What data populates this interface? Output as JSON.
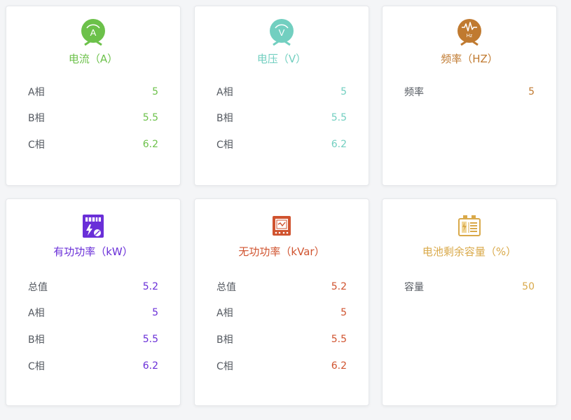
{
  "cards": [
    {
      "title": "电流（A）",
      "icon": "ammeter-icon",
      "color": "#6cc14a",
      "rows": [
        {
          "label": "A相",
          "value": "5"
        },
        {
          "label": "B相",
          "value": "5.5"
        },
        {
          "label": "C相",
          "value": "6.2"
        }
      ]
    },
    {
      "title": "电压（V）",
      "icon": "voltmeter-icon",
      "color": "#72cfc0",
      "rows": [
        {
          "label": "A相",
          "value": "5"
        },
        {
          "label": "B相",
          "value": "5.5"
        },
        {
          "label": "C相",
          "value": "6.2"
        }
      ]
    },
    {
      "title": "频率（HZ）",
      "icon": "frequency-icon",
      "color": "#c07a30",
      "rows": [
        {
          "label": "频率",
          "value": "5"
        }
      ]
    },
    {
      "title": "有功功率（kW）",
      "icon": "active-power-meter-icon",
      "color": "#6a2fd8",
      "rows": [
        {
          "label": "总值",
          "value": "5.2"
        },
        {
          "label": "A相",
          "value": "5"
        },
        {
          "label": "B相",
          "value": "5.5"
        },
        {
          "label": "C相",
          "value": "6.2"
        }
      ]
    },
    {
      "title": "无功功率（kVar）",
      "icon": "reactive-power-meter-icon",
      "color": "#d0532f",
      "rows": [
        {
          "label": "总值",
          "value": "5.2"
        },
        {
          "label": "A相",
          "value": "5"
        },
        {
          "label": "B相",
          "value": "5.5"
        },
        {
          "label": "C相",
          "value": "6.2"
        }
      ]
    },
    {
      "title": "电池剩余容量（%）",
      "icon": "battery-icon",
      "color": "#d9a94a",
      "rows": [
        {
          "label": "容量",
          "value": "50"
        }
      ]
    }
  ]
}
